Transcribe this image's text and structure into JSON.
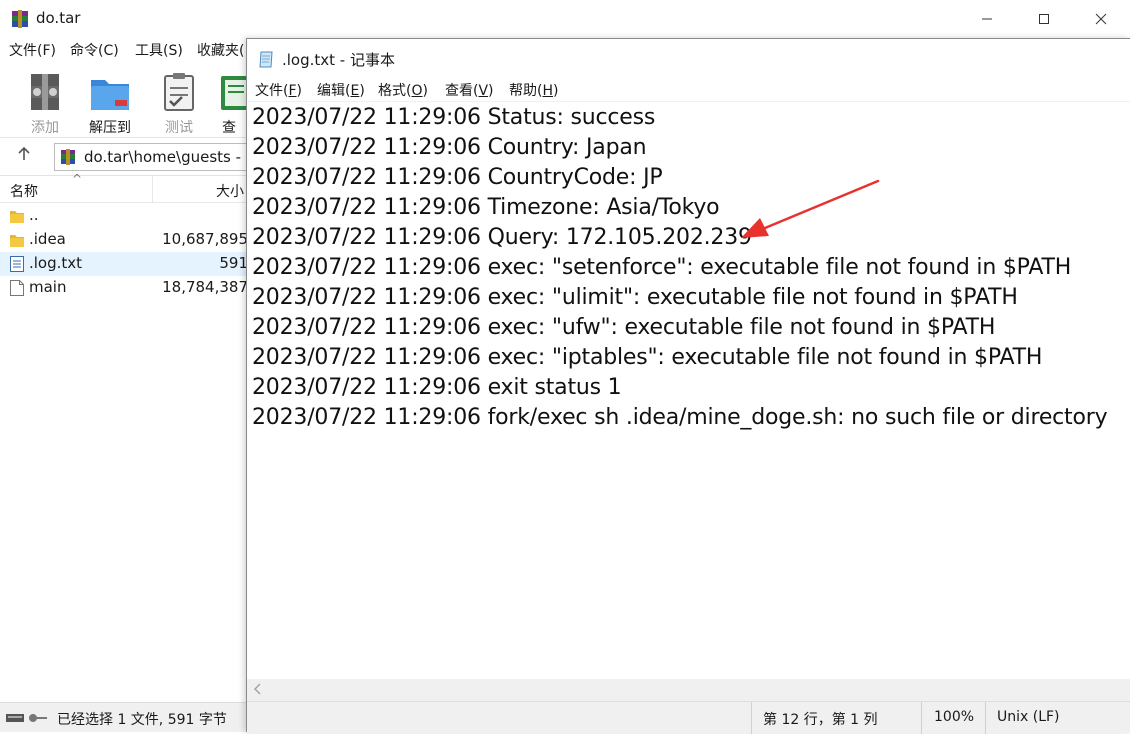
{
  "winrar": {
    "title": "do.tar",
    "menus": [
      "文件(F)",
      "命令(C)",
      "工具(S)",
      "收藏夹("
    ],
    "toolbar": [
      {
        "label": "添加",
        "icon": "add-archive-icon",
        "enabled": false
      },
      {
        "label": "解压到",
        "icon": "extract-to-icon",
        "enabled": true
      },
      {
        "label": "测试",
        "icon": "test-icon",
        "enabled": false
      },
      {
        "label": "查",
        "icon": "view-icon",
        "enabled": true
      }
    ],
    "path": "do.tar\\home\\guests - ",
    "columns": {
      "name": "名称",
      "size": "大小"
    },
    "files": [
      {
        "name": "..",
        "size": "",
        "icon": "folder-icon"
      },
      {
        "name": ".idea",
        "size": "10,687,895",
        "icon": "folder-icon"
      },
      {
        "name": ".log.txt",
        "size": "591",
        "icon": "text-file-icon"
      },
      {
        "name": "main",
        "size": "18,784,387",
        "icon": "file-icon"
      }
    ],
    "status": "已经选择 1 文件, 591 字节"
  },
  "notepad": {
    "title": ".log.txt - 记事本",
    "menus": [
      {
        "label": "文件(F)",
        "key": "F"
      },
      {
        "label": "编辑(E)",
        "key": "E"
      },
      {
        "label": "格式(O)",
        "key": "O"
      },
      {
        "label": "查看(V)",
        "key": "V"
      },
      {
        "label": "帮助(H)",
        "key": "H"
      }
    ],
    "lines": [
      "2023/07/22 11:29:06 Status: success",
      "2023/07/22 11:29:06 Country: Japan",
      "2023/07/22 11:29:06 CountryCode: JP",
      "2023/07/22 11:29:06 Timezone: Asia/Tokyo",
      "2023/07/22 11:29:06 Query: 172.105.202.239",
      "2023/07/22 11:29:06 exec: \"setenforce\": executable file not found in $PATH",
      "2023/07/22 11:29:06 exec: \"ulimit\": executable file not found in $PATH",
      "2023/07/22 11:29:06 exec: \"ufw\": executable file not found in $PATH",
      "2023/07/22 11:29:06 exec: \"iptables\": executable file not found in $PATH",
      "2023/07/22 11:29:06 exit status 1",
      "2023/07/22 11:29:06 fork/exec sh .idea/mine_doge.sh: no such file or directory"
    ],
    "status": {
      "position": "第 12 行，第 1 列",
      "zoom": "100%",
      "line_ending": "Unix (LF)"
    }
  },
  "annotation": {
    "color": "#e8322e",
    "points_to_line": 5
  },
  "colors": {
    "selection": "#e5f3ff",
    "chrome": "#f0f0f0"
  }
}
